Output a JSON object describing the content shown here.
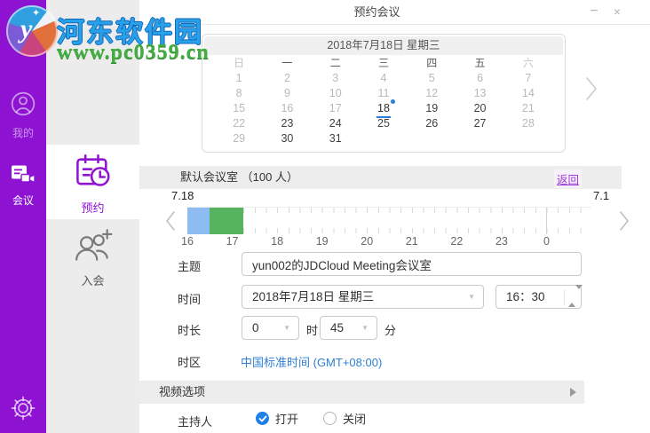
{
  "window": {
    "title": "预约会议",
    "minimize_label": "−",
    "close_label": "×"
  },
  "watermark": {
    "site_name": "河东软件园",
    "site_url": "www.pc0359.cn",
    "logo_letter": "y",
    "logo_star": "✦"
  },
  "sidebar": {
    "rail": [
      {
        "label": "我的",
        "icon": "user-icon",
        "active": false
      },
      {
        "label": "会议",
        "icon": "meeting-video-icon",
        "active": true
      }
    ],
    "settings": {
      "icon": "gear-icon"
    },
    "tabs": [
      {
        "label": "预约",
        "icon": "calendar-clock-icon",
        "active": true
      },
      {
        "label": "入会",
        "icon": "join-people-icon",
        "active": false
      }
    ]
  },
  "calendar": {
    "title": "2018年7月18日 星期三",
    "day_names": [
      {
        "t": "日",
        "muted": true
      },
      {
        "t": "一",
        "muted": false
      },
      {
        "t": "二",
        "muted": false
      },
      {
        "t": "三",
        "muted": false
      },
      {
        "t": "四",
        "muted": false
      },
      {
        "t": "五",
        "muted": false
      },
      {
        "t": "六",
        "muted": true
      }
    ],
    "weeks": [
      [
        {
          "d": 1,
          "s": "m"
        },
        {
          "d": 2,
          "s": "m"
        },
        {
          "d": 3,
          "s": "m"
        },
        {
          "d": 4,
          "s": "m"
        },
        {
          "d": 5,
          "s": "m"
        },
        {
          "d": 6,
          "s": "m"
        },
        {
          "d": 7,
          "s": "m"
        }
      ],
      [
        {
          "d": 8,
          "s": "m"
        },
        {
          "d": 9,
          "s": "m"
        },
        {
          "d": 10,
          "s": "m"
        },
        {
          "d": 11,
          "s": "m"
        },
        {
          "d": 12,
          "s": "m"
        },
        {
          "d": 13,
          "s": "m"
        },
        {
          "d": 14,
          "s": "m"
        }
      ],
      [
        {
          "d": 15,
          "s": "m"
        },
        {
          "d": 16,
          "s": "m"
        },
        {
          "d": 17,
          "s": "m"
        },
        {
          "d": 18,
          "s": "sel"
        },
        {
          "d": 19,
          "s": "n"
        },
        {
          "d": 20,
          "s": "n"
        },
        {
          "d": 21,
          "s": "m"
        }
      ],
      [
        {
          "d": 22,
          "s": "m"
        },
        {
          "d": 23,
          "s": "n"
        },
        {
          "d": 24,
          "s": "n"
        },
        {
          "d": 25,
          "s": "n"
        },
        {
          "d": 26,
          "s": "n"
        },
        {
          "d": 27,
          "s": "n"
        },
        {
          "d": 28,
          "s": "m"
        }
      ],
      [
        {
          "d": 29,
          "s": "m"
        },
        {
          "d": 30,
          "s": "n"
        },
        {
          "d": 31,
          "s": "n"
        },
        null,
        null,
        null,
        null
      ]
    ],
    "selected_day": 18,
    "next_arrow": "›"
  },
  "room_bar": {
    "title": "默认会议室 （100 人）",
    "back_link": "返回"
  },
  "timeline": {
    "left_date": "7.18",
    "right_date": "7.1",
    "prev_arrow": "‹",
    "next_arrow": "›",
    "origin_hour": 16,
    "hours": [
      {
        "label": "16",
        "h": 16
      },
      {
        "label": "17",
        "h": 17
      },
      {
        "label": "18",
        "h": 18
      },
      {
        "label": "19",
        "h": 19
      },
      {
        "label": "20",
        "h": 20
      },
      {
        "label": "21",
        "h": 21
      },
      {
        "label": "22",
        "h": 22
      },
      {
        "label": "23",
        "h": 23
      },
      {
        "label": "0",
        "h": 24
      }
    ],
    "day_boundary_hour": 24,
    "segments": [
      {
        "start": 16,
        "end": 16.5,
        "color": "#8cbcf2",
        "kind": "busy"
      },
      {
        "start": 16.5,
        "end": 17.25,
        "color": "#56b45f",
        "kind": "selected"
      }
    ]
  },
  "form": {
    "topic": {
      "label": "主题",
      "value": "yun002的JDCloud Meeting会议室"
    },
    "time": {
      "label": "时间",
      "date_value": "2018年7月18日 星期三",
      "clock_value": "16：30"
    },
    "duration": {
      "label": "时长",
      "hours_value": "0",
      "hours_unit": "时",
      "minutes_value": "45",
      "minutes_unit": "分"
    },
    "timezone": {
      "label": "时区",
      "value": "中国标准时间 (GMT+08:00)"
    },
    "video_options": {
      "label": "视频选项"
    },
    "host": {
      "label": "主持人",
      "options": [
        {
          "label": "打开",
          "checked": true
        },
        {
          "label": "关闭",
          "checked": false
        }
      ]
    }
  },
  "colors": {
    "sidebar_purple": "#8d12d1",
    "accent_purple": "#9013d2",
    "selected_blue": "#2b7de0",
    "link_blue": "#2f7fd6",
    "busy_segment_blue": "#8cbcf2",
    "selected_segment_green": "#56b45f",
    "back_link_purple": "#a23bd9"
  }
}
